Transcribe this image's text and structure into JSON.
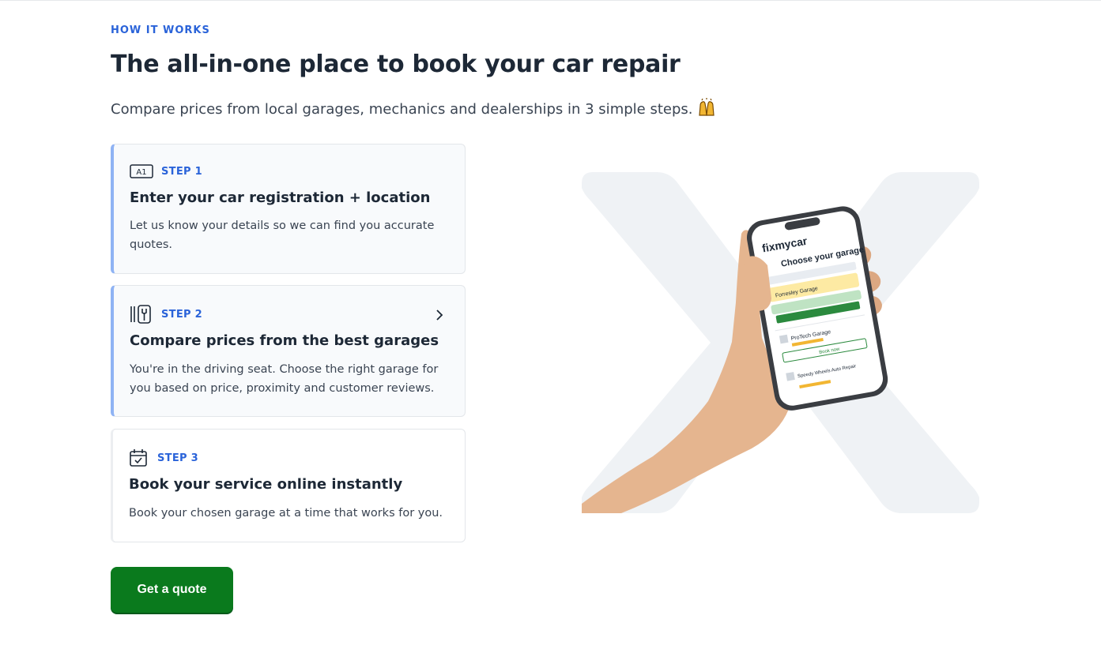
{
  "section": {
    "eyebrow": "HOW IT WORKS",
    "title": "The all-in-one place to book your car repair",
    "subtitle": "Compare prices from local garages, mechanics and dealerships in 3 simple steps."
  },
  "steps": [
    {
      "icon": "registration-plate-icon",
      "label": "STEP 1",
      "title": "Enter your car registration + location",
      "description": "Let us know your details so we can find you accurate quotes."
    },
    {
      "icon": "garage-tools-icon",
      "label": "STEP 2",
      "title": "Compare prices from the best garages",
      "description": "You're in the driving seat. Choose the right garage for you based on price, proximity and customer reviews."
    },
    {
      "icon": "calendar-check-icon",
      "label": "STEP 3",
      "title": "Book your service online instantly",
      "description": "Book your chosen garage at a time that works for you."
    }
  ],
  "cta": {
    "label": "Get a quote"
  },
  "phone_screen": {
    "brand": "fixmycar",
    "heading": "Choose your garage",
    "garages": [
      {
        "name": "Forresley Garage"
      },
      {
        "name": "ProTech Garage",
        "button": "Book now"
      },
      {
        "name": "Speedy Wheels Auto Repair"
      }
    ]
  },
  "colors": {
    "accent_blue": "#2a63d9",
    "cta_green": "#0a7a1d",
    "active_bar": "#8fb3f4",
    "text_dark": "#1d2836"
  }
}
